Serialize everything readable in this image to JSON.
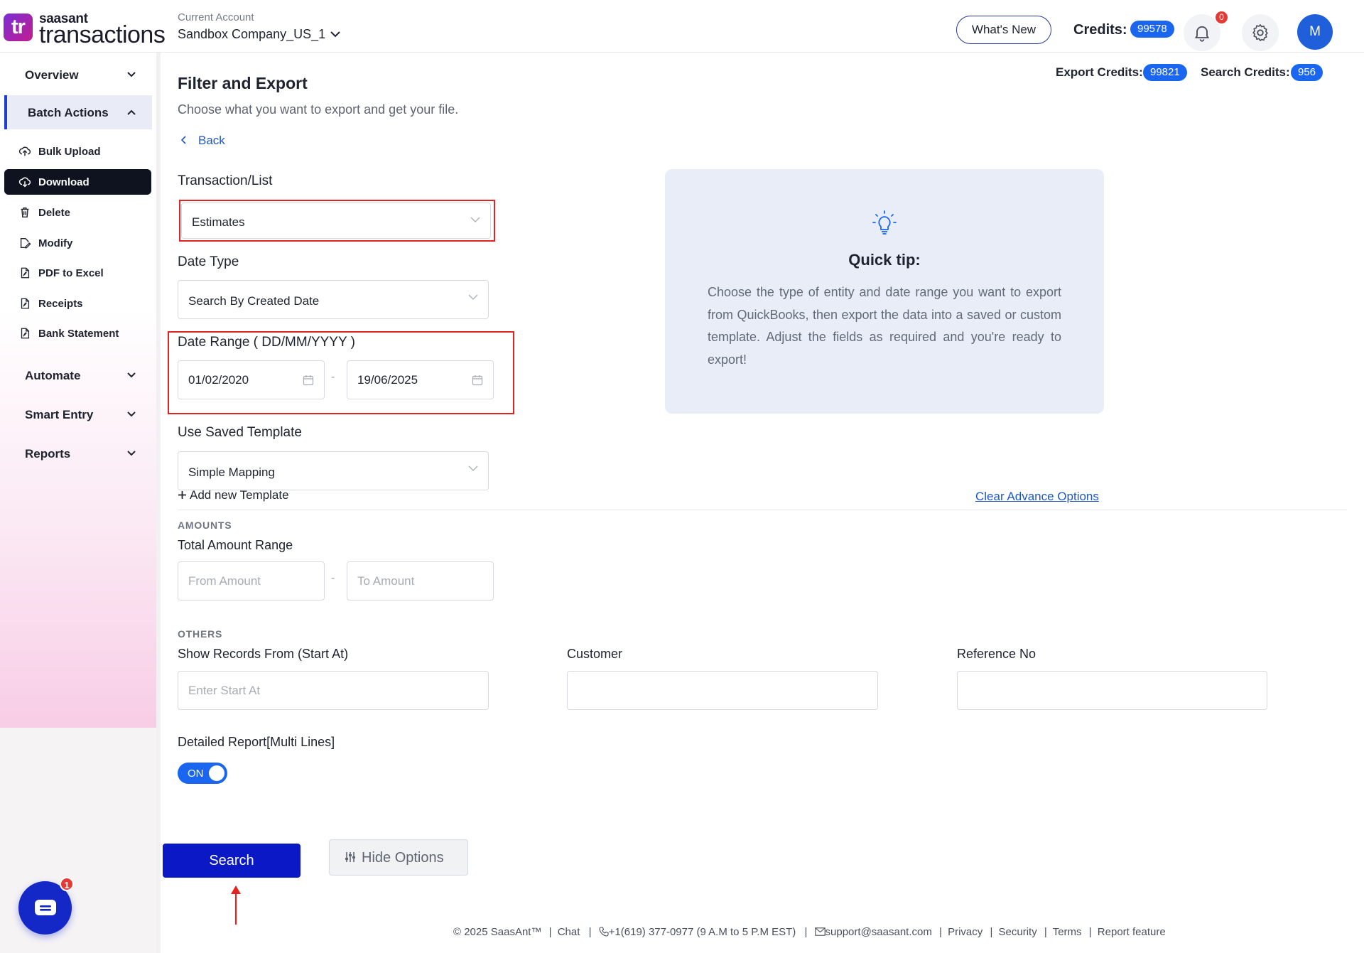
{
  "brand": {
    "logo_mark": "tr",
    "logo_top": "saasant",
    "logo_main": "transactions"
  },
  "header": {
    "current_account_label": "Current Account",
    "account_name": "Sandbox Company_US_1",
    "whats_new_label": "What's New",
    "credits_label": "Credits:",
    "credits_value": "99578",
    "notification_count": "0",
    "avatar_initial": "M"
  },
  "sidebar": {
    "groups": {
      "overview": "Overview",
      "batch_actions": "Batch Actions",
      "automate": "Automate",
      "smart_entry": "Smart Entry",
      "reports": "Reports"
    },
    "items": {
      "bulk_upload": "Bulk Upload",
      "download": "Download",
      "delete": "Delete",
      "modify": "Modify",
      "pdf_to_excel": "PDF to Excel",
      "receipts": "Receipts",
      "bank_statement": "Bank Statement"
    },
    "chat_badge": "1"
  },
  "main": {
    "title": "Filter and Export",
    "subtitle": "Choose what you want to export and get your file.",
    "back_label": "Back",
    "export_credits_label": "Export Credits:",
    "export_credits_value": "99821",
    "search_credits_label": "Search Credits:",
    "search_credits_value": "956",
    "transaction_list": {
      "label": "Transaction/List",
      "value": "Estimates"
    },
    "date_type": {
      "label": "Date Type",
      "value": "Search By Created Date"
    },
    "date_range": {
      "label": "Date Range ( DD/MM/YYYY )",
      "from": "01/02/2020",
      "separator": "-",
      "to": "19/06/2025"
    },
    "saved_template": {
      "label": "Use Saved Template",
      "value": "Simple Mapping",
      "add_new": "Add new Template"
    },
    "clear_advance": "Clear Advance Options",
    "amounts": {
      "section": "AMOUNTS",
      "label": "Total Amount Range",
      "from_placeholder": "From Amount",
      "separator": "-",
      "to_placeholder": "To Amount"
    },
    "others": {
      "section": "OTHERS",
      "start_at_label": "Show Records From (Start At)",
      "start_at_placeholder": "Enter Start At",
      "customer_label": "Customer",
      "reference_label": "Reference No"
    },
    "detailed_report": {
      "label": "Detailed Report[Multi Lines]",
      "toggle_text": "ON"
    },
    "search_button": "Search",
    "hide_options_button": "Hide Options",
    "quick_tip": {
      "title": "Quick tip:",
      "body": "Choose the type of entity and date range you want to export from QuickBooks, then export the data into a saved or custom template. Adjust the fields as required and you're ready to export!"
    }
  },
  "footer": {
    "copyright": "© 2025 SaasAnt™",
    "chat": "Chat",
    "phone": "+1(619) 377-0977 (9 A.M to 5 P.M EST)",
    "email": "support@saasant.com",
    "privacy": "Privacy",
    "security": "Security",
    "terms": "Terms",
    "report_feature": "Report feature",
    "separator": "|"
  },
  "colors": {
    "primary_blue": "#1a66f0",
    "search_button": "#0a18c6",
    "highlight_red": "#e02424",
    "tip_background": "#e8edf8"
  }
}
